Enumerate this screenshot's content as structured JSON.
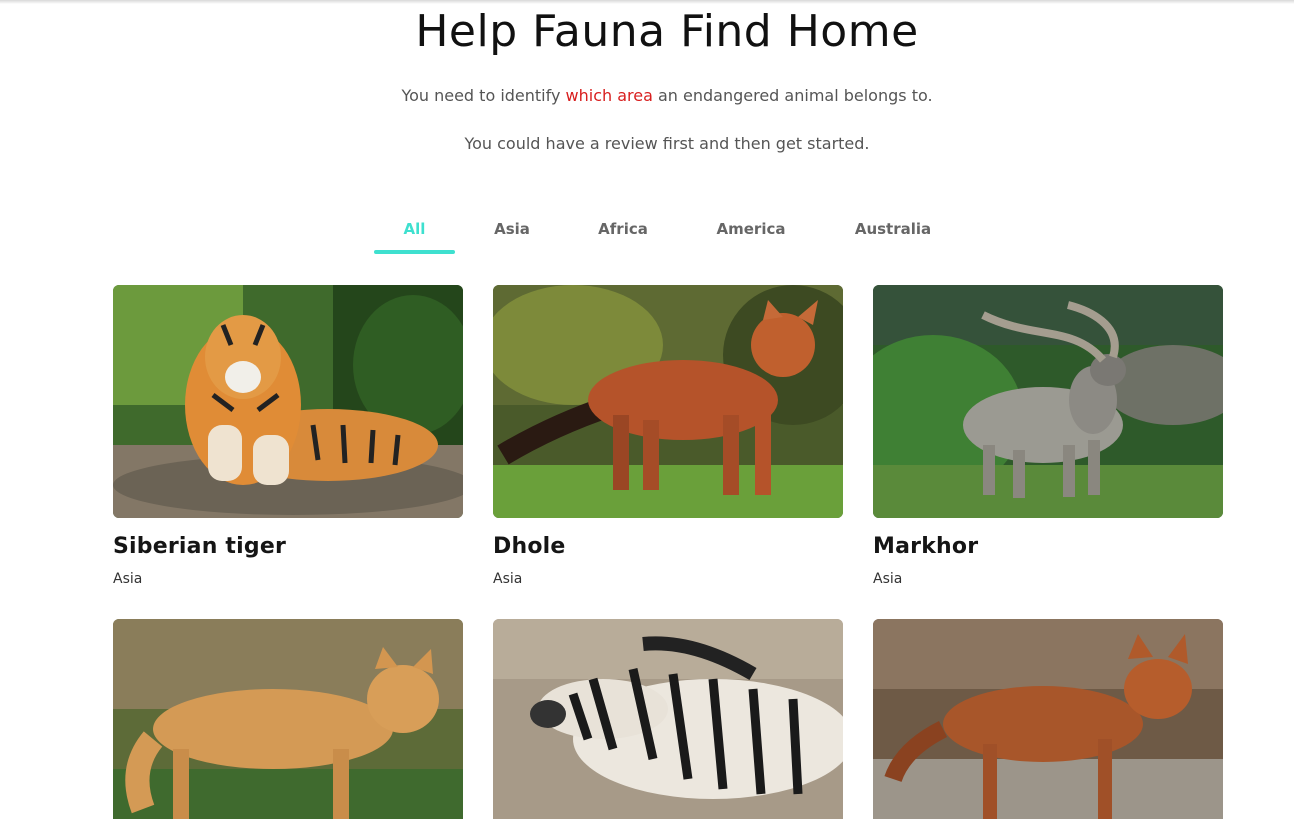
{
  "page": {
    "title": "Help Fauna Find Home",
    "intro_prefix": "You need to identify ",
    "intro_highlight": "which area",
    "intro_suffix": " an endangered animal belongs to.",
    "intro_line2": "You could have a review first and then get started.",
    "accent_color": "#d81e1e"
  },
  "filters": {
    "active_color": "#3ee0cf",
    "tabs": [
      {
        "label": "All",
        "active": true
      },
      {
        "label": "Asia",
        "active": false
      },
      {
        "label": "Africa",
        "active": false
      },
      {
        "label": "America",
        "active": false
      },
      {
        "label": "Australia",
        "active": false
      }
    ]
  },
  "animals": [
    {
      "name": "Siberian tiger",
      "region": "Asia",
      "image": "tiger-photo"
    },
    {
      "name": "Dhole",
      "region": "Asia",
      "image": "dhole-photo"
    },
    {
      "name": "Markhor",
      "region": "Asia",
      "image": "markhor-photo"
    },
    {
      "name": "",
      "region": "",
      "image": "dingo-photo"
    },
    {
      "name": "",
      "region": "",
      "image": "zebra-photo"
    },
    {
      "name": "",
      "region": "",
      "image": "ethiopian-wolf-photo"
    }
  ]
}
